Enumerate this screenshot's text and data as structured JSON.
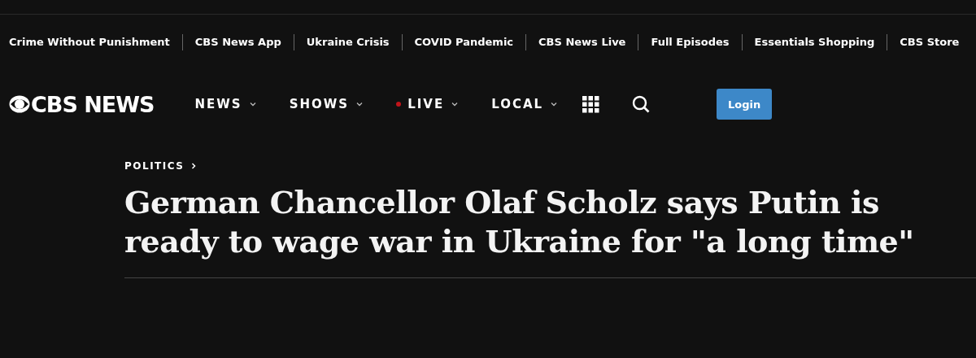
{
  "topics": [
    "Crime Without Punishment",
    "CBS News App",
    "Ukraine Crisis",
    "COVID Pandemic",
    "CBS News Live",
    "Full Episodes",
    "Essentials Shopping",
    "CBS Store"
  ],
  "logo": {
    "text": "CBS NEWS"
  },
  "nav": [
    {
      "label": "NEWS",
      "kind": "menu"
    },
    {
      "label": "SHOWS",
      "kind": "menu"
    },
    {
      "label": "LIVE",
      "kind": "live"
    },
    {
      "label": "LOCAL",
      "kind": "menu"
    }
  ],
  "login": "Login",
  "article": {
    "section": "POLITICS",
    "headline": "German Chancellor Olaf Scholz says Putin is ready to wage war in Ukraine for \"a long time\""
  }
}
